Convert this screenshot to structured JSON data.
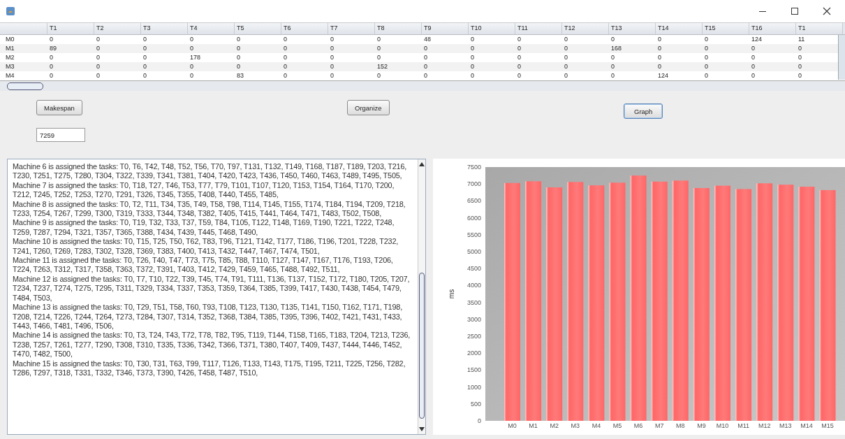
{
  "table": {
    "columns": [
      "",
      "T1",
      "T2",
      "T3",
      "T4",
      "T5",
      "T6",
      "T7",
      "T8",
      "T9",
      "T10",
      "T11",
      "T12",
      "T13",
      "T14",
      "T15",
      "T16",
      "T1"
    ],
    "rows": [
      [
        "M0",
        "0",
        "0",
        "0",
        "0",
        "0",
        "0",
        "0",
        "0",
        "48",
        "0",
        "0",
        "0",
        "0",
        "0",
        "0",
        "124",
        "11"
      ],
      [
        "M1",
        "89",
        "0",
        "0",
        "0",
        "0",
        "0",
        "0",
        "0",
        "0",
        "0",
        "0",
        "0",
        "168",
        "0",
        "0",
        "0",
        "0"
      ],
      [
        "M2",
        "0",
        "0",
        "0",
        "178",
        "0",
        "0",
        "0",
        "0",
        "0",
        "0",
        "0",
        "0",
        "0",
        "0",
        "0",
        "0",
        "0"
      ],
      [
        "M3",
        "0",
        "0",
        "0",
        "0",
        "0",
        "0",
        "0",
        "152",
        "0",
        "0",
        "0",
        "0",
        "0",
        "0",
        "0",
        "0",
        "0"
      ],
      [
        "M4",
        "0",
        "0",
        "0",
        "0",
        "83",
        "0",
        "0",
        "0",
        "0",
        "0",
        "0",
        "0",
        "0",
        "124",
        "0",
        "0",
        "0"
      ]
    ]
  },
  "buttons": [
    {
      "label": "Makespan",
      "selected": false
    },
    {
      "label": "Organize",
      "selected": false
    },
    {
      "label": "Graph",
      "selected": true
    }
  ],
  "makespan_value": "7259",
  "output_lines": [
    "Machine 6 is assigned the tasks: T0, T6, T42, T48, T52, T56, T70, T97, T131, T132, T149, T168, T187, T189, T203, T216, T230, T251, T275, T280, T304, T322, T339, T341, T381, T404, T420, T423, T436, T450, T460, T463, T489, T495, T505,",
    "Machine 7 is assigned the tasks: T0, T18, T27, T46, T53, T77, T79, T101, T107, T120, T153, T154, T164, T170, T200, T212, T245, T252, T253, T270, T291, T326, T345, T355, T408, T440, T455, T485,",
    "Machine 8 is assigned the tasks: T0, T2, T11, T34, T35, T49, T58, T98, T114, T145, T155, T174, T184, T194, T209, T218, T233, T254, T267, T299, T300, T319, T333, T344, T348, T382, T405, T415, T441, T464, T471, T483, T502, T508,",
    "Machine 9 is assigned the tasks: T0, T19, T32, T33, T37, T59, T84, T105, T122, T148, T169, T190, T221, T222, T248, T259, T287, T294, T321, T357, T365, T388, T434, T439, T445, T468, T490,",
    "Machine 10 is assigned the tasks: T0, T15, T25, T50, T62, T83, T96, T121, T142, T177, T186, T196, T201, T228, T232, T241, T260, T269, T283, T302, T328, T369, T383, T400, T413, T432, T447, T467, T474, T501,",
    "Machine 11 is assigned the tasks: T0, T26, T40, T47, T73, T75, T85, T88, T110, T127, T147, T167, T176, T193, T206, T224, T263, T312, T317, T358, T363, T372, T391, T403, T412, T429, T459, T465, T488, T492, T511,",
    "Machine 12 is assigned the tasks: T0, T7, T10, T22, T39, T45, T74, T91, T111, T136, T137, T152, T172, T180, T205, T207, T234, T237, T274, T275, T295, T311, T329, T334, T337, T353, T359, T364, T385, T399, T417, T430, T438, T454, T479, T484, T503,",
    "Machine 13 is assigned the tasks: T0, T29, T51, T58, T60, T93, T108, T123, T130, T135, T141, T150, T162, T171, T198, T208, T214, T226, T244, T264, T273, T284, T307, T314, T352, T368, T384, T385, T395, T396, T402, T421, T431, T433, T443, T466, T481, T496, T506,",
    "Machine 14 is assigned the tasks: T0, T3, T24, T43, T72, T78, T82, T95, T119, T144, T158, T165, T183, T204, T213, T236, T238, T257, T261, T277, T290, T308, T310, T335, T336, T342, T366, T371, T380, T407, T409, T437, T444, T446, T452, T470, T482, T500,",
    "Machine 15 is assigned the tasks: T0, T30, T31, T63, T99, T117, T126, T133, T143, T175, T195, T211, T225, T256, T282, T286, T297, T318, T331, T332, T346, T373, T390, T426, T458, T487, T510,"
  ],
  "chart": {
    "chart_data": {
      "type": "bar",
      "ylabel": "ms",
      "categories": [
        "M0",
        "M1",
        "M2",
        "M3",
        "M4",
        "M5",
        "M6",
        "M7",
        "M8",
        "M9",
        "M10",
        "M11",
        "M12",
        "M13",
        "M14",
        "M15"
      ],
      "series": [
        {
          "color": "#ff6666",
          "values": [
            7030,
            7080,
            6900,
            7060,
            6960,
            7040,
            7250,
            7070,
            7100,
            6880,
            6950,
            6850,
            7020,
            6980,
            6920,
            6820
          ]
        }
      ],
      "ylim": [
        0,
        7500
      ],
      "yticks": [
        0,
        500,
        1000,
        1500,
        2000,
        2500,
        3000,
        3500,
        4000,
        4500,
        5000,
        5500,
        6000,
        6500,
        7000,
        7500
      ]
    }
  }
}
